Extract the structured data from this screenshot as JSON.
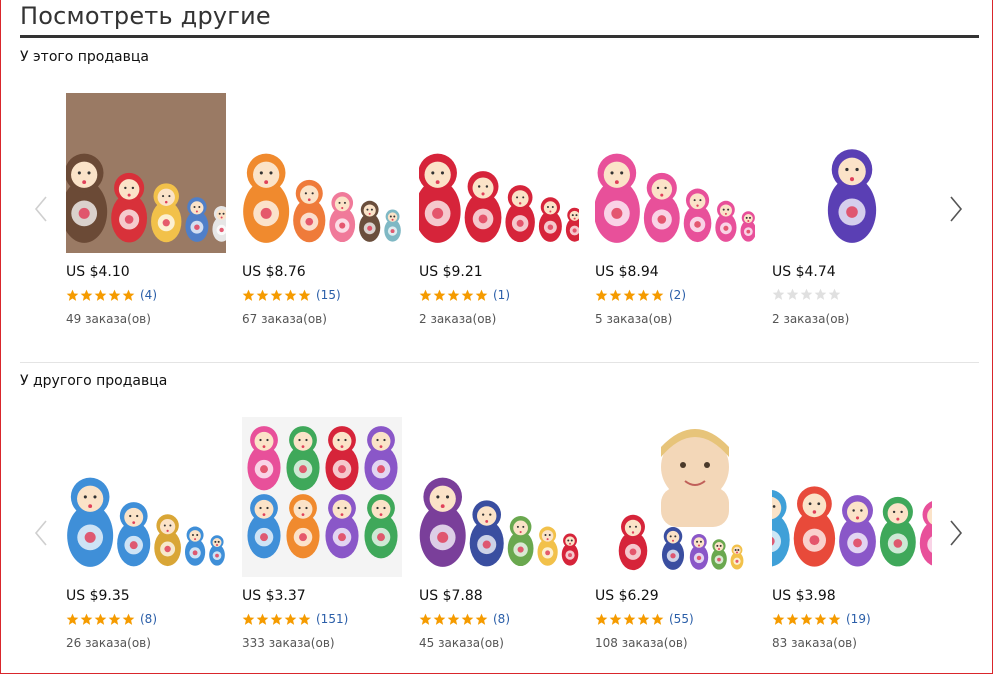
{
  "page": {
    "title": "Посмотреть другие"
  },
  "colors": {
    "accent_border": "#d9262c",
    "star_filled": "#f59b00",
    "star_empty": "#e0e0e0",
    "review_link": "#2a5ea8"
  },
  "icons": {
    "prev": "chevron-left-icon",
    "next": "chevron-right-icon",
    "star": "star-icon"
  },
  "sections": [
    {
      "heading": "У этого продавца",
      "products": [
        {
          "image": "bear-fox-owl-nesting-dolls",
          "price": "US $4.10",
          "rating": 5,
          "reviews": "(4)",
          "orders": "49 заказа(ов)"
        },
        {
          "image": "lion-tiger-animal-nesting-dolls",
          "price": "US $8.76",
          "rating": 5,
          "reviews": "(15)",
          "orders": "67 заказа(ов)"
        },
        {
          "image": "red-black-floral-nesting-dolls",
          "price": "US $9.21",
          "rating": 5,
          "reviews": "(1)",
          "orders": "2 заказа(ов)"
        },
        {
          "image": "pink-butterfly-nesting-dolls",
          "price": "US $8.94",
          "rating": 5,
          "reviews": "(2)",
          "orders": "5 заказа(ов)"
        },
        {
          "image": "purple-single-nesting-doll",
          "price": "US $4.74",
          "rating": 0,
          "reviews": "",
          "orders": "2 заказа(ов)"
        }
      ]
    },
    {
      "heading": "У другого продавца",
      "products": [
        {
          "image": "blue-gold-nesting-dolls",
          "price": "US $9.35",
          "rating": 5,
          "reviews": "(8)",
          "orders": "26 заказа(ов)"
        },
        {
          "image": "colorful-eight-doll-grid",
          "price": "US $3.37",
          "rating": 5,
          "reviews": "(151)",
          "orders": "333 заказа(ов)"
        },
        {
          "image": "purple-green-nesting-dolls",
          "price": "US $7.88",
          "rating": 5,
          "reviews": "(8)",
          "orders": "45 заказа(ов)"
        },
        {
          "image": "girl-with-nesting-dolls",
          "price": "US $6.29",
          "rating": 5,
          "reviews": "(55)",
          "orders": "108 заказа(ов)"
        },
        {
          "image": "pastel-rose-nesting-dolls",
          "price": "US $3.98",
          "rating": 5,
          "reviews": "(19)",
          "orders": "83 заказа(ов)"
        }
      ]
    }
  ]
}
